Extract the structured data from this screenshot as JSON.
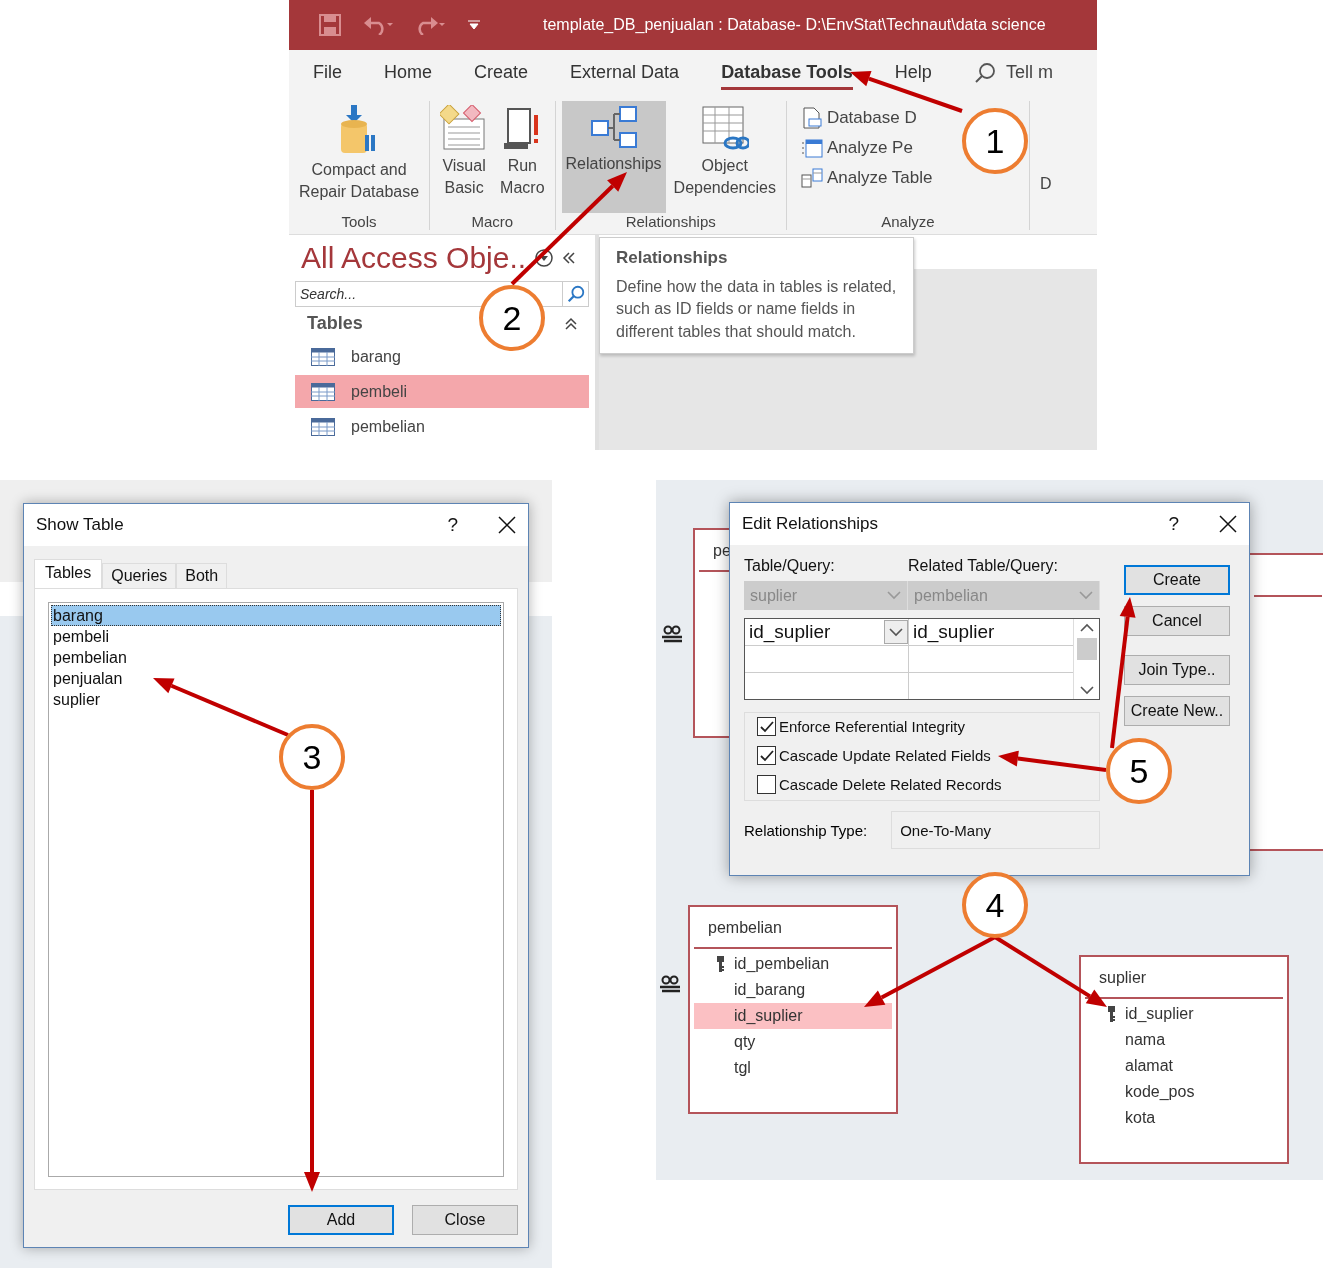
{
  "access_window": {
    "title": "template_DB_penjualan : Database- D:\\EnvStat\\Technaut\\data science",
    "tabs": [
      {
        "label": "File",
        "selected": false
      },
      {
        "label": "Home",
        "selected": false
      },
      {
        "label": "Create",
        "selected": false
      },
      {
        "label": "External Data",
        "selected": false
      },
      {
        "label": "Database Tools",
        "selected": true
      },
      {
        "label": "Help",
        "selected": false
      }
    ],
    "tell_me": "Tell m",
    "ribbon_groups": [
      {
        "label": "Tools",
        "buttons": [
          {
            "label": "Compact and\nRepair Database",
            "kind": "compact",
            "highlighted": false
          }
        ]
      },
      {
        "label": "Macro",
        "buttons": [
          {
            "label": "Visual\nBasic",
            "kind": "vb",
            "highlighted": false
          },
          {
            "label": "Run\nMacro",
            "kind": "macro",
            "highlighted": false
          }
        ]
      },
      {
        "label": "Relationships",
        "buttons": [
          {
            "label": "Relationships",
            "kind": "relationships",
            "highlighted": true
          },
          {
            "label": "Object\nDependencies",
            "kind": "dependencies",
            "highlighted": false
          }
        ]
      },
      {
        "label": "Analyze",
        "small_buttons": [
          {
            "label": "Database D",
            "kind": "documenter"
          },
          {
            "label": "Analyze Pe",
            "kind": "performance"
          },
          {
            "label": "Analyze Table",
            "kind": "table"
          }
        ]
      }
    ],
    "ribbon_cut_label": "D",
    "nav_pane": {
      "title": "All Access Obje..",
      "search": {
        "placeholder": "Search..."
      },
      "section": "Tables",
      "items": [
        {
          "label": "barang",
          "selected": false
        },
        {
          "label": "pembeli",
          "selected": true
        },
        {
          "label": "pembelian",
          "selected": false
        }
      ]
    },
    "tooltip": {
      "title": "Relationships",
      "body": "Define how the data in tables is related, such as ID fields or name fields in different tables that should match."
    }
  },
  "show_table": {
    "title": "Show Table",
    "help": "?",
    "tabs": [
      {
        "label": "Tables",
        "selected": true
      },
      {
        "label": "Queries",
        "selected": false
      },
      {
        "label": "Both",
        "selected": false
      }
    ],
    "items": [
      {
        "label": "barang",
        "selected": true
      },
      {
        "label": "pembeli",
        "selected": false
      },
      {
        "label": "pembelian",
        "selected": false
      },
      {
        "label": "penjualan",
        "selected": false
      },
      {
        "label": "suplier",
        "selected": false
      }
    ],
    "buttons": [
      {
        "label": "Add",
        "default": true
      },
      {
        "label": "Close",
        "default": false
      }
    ]
  },
  "relationships": {
    "hidden_table_title": "pe",
    "dialog": {
      "title": "Edit Relationships",
      "help": "?",
      "table_label": "Table/Query:",
      "related_label": "Related Table/Query:",
      "table": "suplier",
      "related_table": "pembelian",
      "fields": [
        {
          "left": "id_suplier",
          "right": "id_suplier"
        }
      ],
      "options": [
        {
          "label": "Enforce Referential Integrity",
          "checked": true
        },
        {
          "label": "Cascade Update Related Fields",
          "checked": true
        },
        {
          "label": "Cascade Delete Related Records",
          "checked": false
        }
      ],
      "type_label": "Relationship Type:",
      "type_value": "One-To-Many",
      "buttons": [
        {
          "label": "Create",
          "default": true
        },
        {
          "label": "Cancel",
          "default": false
        },
        {
          "label": "Join Type..",
          "default": false
        },
        {
          "label": "Create New..",
          "default": false
        }
      ]
    },
    "tables": [
      {
        "title": "pembelian",
        "fields": [
          {
            "name": "id_pembelian",
            "key": true,
            "selected": false
          },
          {
            "name": "id_barang",
            "key": false,
            "selected": false
          },
          {
            "name": "id_suplier",
            "key": false,
            "selected": true
          },
          {
            "name": "qty",
            "key": false,
            "selected": false
          },
          {
            "name": "tgl",
            "key": false,
            "selected": false
          }
        ]
      },
      {
        "title": "suplier",
        "fields": [
          {
            "name": "id_suplier",
            "key": true,
            "selected": false
          },
          {
            "name": "nama",
            "key": false,
            "selected": false
          },
          {
            "name": "alamat",
            "key": false,
            "selected": false
          },
          {
            "name": "kode_pos",
            "key": false,
            "selected": false
          },
          {
            "name": "kota",
            "key": false,
            "selected": false
          }
        ]
      }
    ]
  },
  "annotations": [
    {
      "number": "1"
    },
    {
      "number": "2"
    },
    {
      "number": "3"
    },
    {
      "number": "4"
    },
    {
      "number": "5"
    }
  ]
}
